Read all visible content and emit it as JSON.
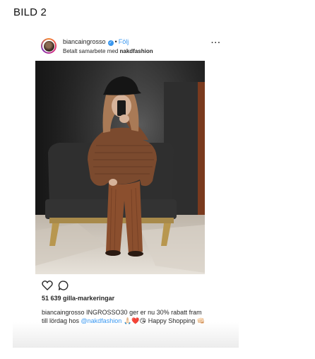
{
  "figure_label": "BILD 2",
  "post": {
    "username": "biancaingrosso",
    "follow_label": "Följ",
    "sponsor_text": "Betalt samarbete med ",
    "sponsor_brand": "nakdfashion",
    "more_label": "···",
    "likes_count": "51 639",
    "likes_label": "gilla-markeringar",
    "caption_author": "biancaingrosso",
    "caption_text": " INGROSSO30 ger er nu 30% rabatt fram till lördag hos ",
    "caption_mention": "@nakdfashion",
    "caption_emojis": " 🙏🏻❤️😘 ",
    "caption_tail": "Happy Shopping 👊🏻"
  },
  "icons": [
    "verified-badge-icon",
    "heart-icon",
    "comment-icon",
    "more-options-icon"
  ],
  "colors": {
    "link": "#3897f0",
    "text": "#262626"
  }
}
